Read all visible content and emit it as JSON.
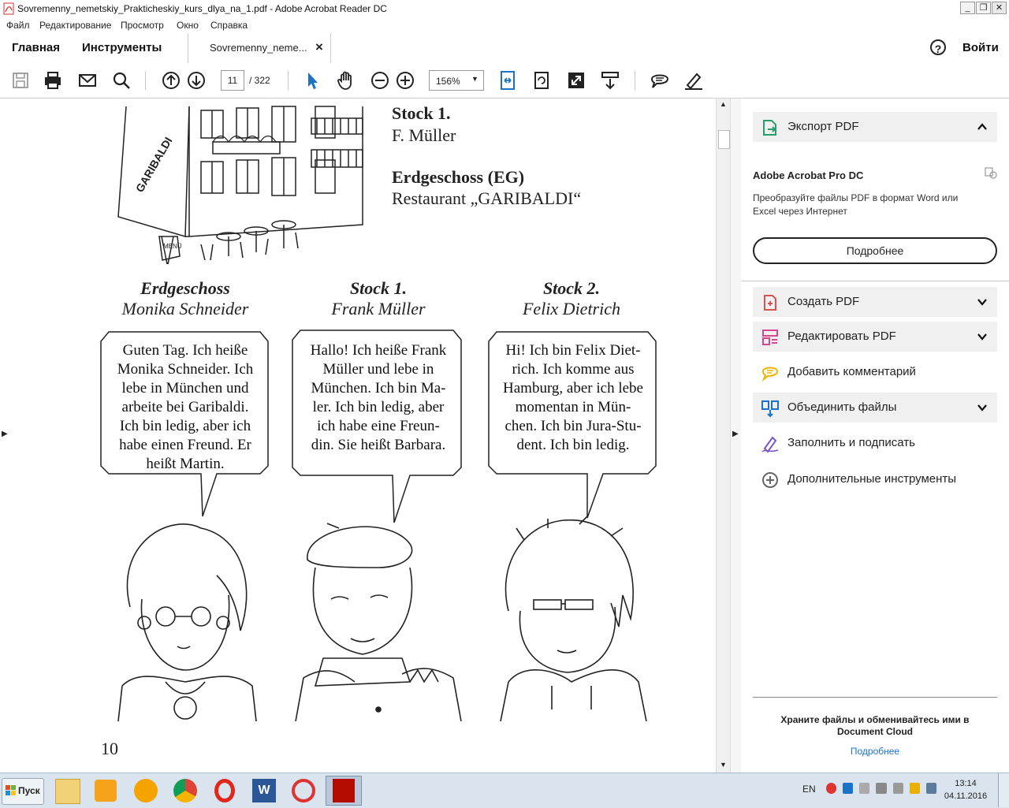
{
  "window": {
    "title": "Sovremenny_nemetskiy_Prakticheskiy_kurs_dlya_na_1.pdf - Adobe Acrobat Reader DC",
    "min": "_",
    "max": "❐",
    "close": "✕"
  },
  "menu": [
    "Файл",
    "Редактирование",
    "Просмотр",
    "Окно",
    "Справка"
  ],
  "tabs": {
    "home": "Главная",
    "tools": "Инструменты",
    "document": "Sovremenny_neme...",
    "close": "×",
    "help": "?",
    "signin": "Войти"
  },
  "toolbar": {
    "page_current": "11",
    "page_total": "/ 322",
    "zoom": "156%"
  },
  "page": {
    "stock1_title": "Stock 1.",
    "stock1_name": "F. Müller",
    "eg_title": "Erdgeschoss (EG)",
    "eg_name": "Restaurant „GARIBALDI“",
    "building_sign": "GARIBALDI",
    "menu_sign": "MENÜ",
    "page_number": "10",
    "characters": [
      {
        "floor": "Erdgeschoss",
        "name": "Monika Schneider",
        "speech": [
          "Guten Tag. Ich heiße",
          "Monika Schneider. Ich",
          "lebe in München und",
          "arbeite bei Garibaldi.",
          "Ich bin ledig, aber ich",
          "habe einen Freund. Er",
          "heißt Martin."
        ]
      },
      {
        "floor": "Stock 1.",
        "name": "Frank Müller",
        "speech": [
          "Hallo! Ich heiße Frank",
          "Müller und lebe in",
          "München. Ich bin Ma-",
          "ler. Ich bin ledig, aber",
          "ich habe eine Freun-",
          "din. Sie heißt Barbara."
        ]
      },
      {
        "floor": "Stock 2.",
        "name": "Felix Dietrich",
        "speech": [
          "Hi! Ich bin Felix Diet-",
          "rich. Ich komme aus",
          "Hamburg, aber ich lebe",
          "momentan in Mün-",
          "chen. Ich bin Jura-Stu-",
          "dent. Ich bin ledig."
        ]
      }
    ]
  },
  "panel": {
    "export": "Экспорт PDF",
    "product": "Adobe Acrobat Pro DC",
    "desc_line1": "Преобразуйте файлы PDF в формат Word или",
    "desc_line2": "Excel через Интернет",
    "more_button": "Подробнее",
    "create": "Создать PDF",
    "edit": "Редактировать PDF",
    "comment": "Добавить комментарий",
    "combine": "Объединить файлы",
    "fill_sign": "Заполнить и подписать",
    "more_tools": "Дополнительные инструменты",
    "cloud_line1": "Храните файлы и обменивайтесь ими в",
    "cloud_line2": "Document Cloud",
    "cloud_link": "Подробнее"
  },
  "taskbar": {
    "start": "Пуск",
    "lang": "EN",
    "time": "13:14",
    "date": "04.11.2016"
  },
  "colors": {
    "accent_blue": "#1a73c8",
    "export_green": "#2a9d6f",
    "create_red": "#d9534f",
    "edit_pink": "#d9468f",
    "comment_yellow": "#f0b400",
    "fill_purple": "#7a55c8",
    "taskbar": "#d9e4ee"
  }
}
